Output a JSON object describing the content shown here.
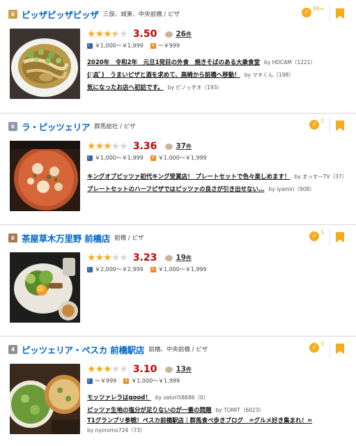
{
  "restaurants": [
    {
      "rank_label": "",
      "rank_style": "gold",
      "name": "ピッザピッザピッザ",
      "area": "三俣、城東、中央前橋 / ピザ",
      "save_count": "99+",
      "rating": 3.5,
      "score": "3.50",
      "review_count": "26",
      "review_unit": "件",
      "dinner_price": "￥1,000～￥1,999",
      "lunch_price": "～￥999",
      "reviews": [
        {
          "title": "2020年　令和2年　元旦1発目の外食　焼きそばのある大衆食堂",
          "by": "by HDCAM（1221）"
        },
        {
          "title": "(ﾟДﾟ)　うまいピザと酒を求めて、高崎から前橋へ移動！",
          "by": "by マキくん（198）"
        },
        {
          "title": "気になったお店へ初訪です。",
          "by": "by ピノッチオ（193）"
        }
      ]
    },
    {
      "rank_label": "",
      "rank_style": "silver",
      "name": "ラ・ピッツェリア",
      "area": "群馬総社 / ピザ",
      "save_count": "2",
      "rating": 3.0,
      "score": "3.36",
      "review_count": "37",
      "review_unit": "件",
      "dinner_price": "￥1,000～￥1,999",
      "lunch_price": "￥1,000～￥1,999",
      "reviews": [
        {
          "title": "キングオブピッツァ初代キング受賞店！ プレートセットで色々楽しめます！",
          "by": "by まっすーTV（37）"
        },
        {
          "title": "プレートセットのハーフピザではピッツァの良さが引き出せない…",
          "by": "by iyamin（908）"
        }
      ]
    },
    {
      "rank_label": "",
      "rank_style": "bronze",
      "name": "茶屋草木万里野 前橋店",
      "area": "前橋 / ピザ",
      "save_count": "1",
      "rating": 3.0,
      "score": "3.23",
      "review_count": "19",
      "review_unit": "件",
      "dinner_price": "￥2,000～￥2,999",
      "lunch_price": "￥1,000～￥1,999",
      "reviews": []
    },
    {
      "rank_label": "4",
      "rank_style": "plain",
      "name": "ピッツェリア・ペスカ 前橋駅店",
      "area": "前橋、中央前橋 / ピザ",
      "save_count": "3",
      "rating": 3.0,
      "score": "3.10",
      "review_count": "13",
      "review_unit": "件",
      "dinner_price": "～￥999",
      "lunch_price": "￥1,000～￥1,999",
      "reviews": [
        {
          "title": "モッツァレラはgood！",
          "by": "by satori58686（0）"
        },
        {
          "title": "ピッツァ生地の塩分が足りないのが一番の問題",
          "by": "by TOMIT（6023）"
        },
        {
          "title": "T1グランプリ参戦！ペスカ前橋駅店｜群馬食べ歩きブログ　=グルメ好き集まれ！=",
          "by": "by nyoromo724（73）",
          "wrap": true
        }
      ]
    }
  ],
  "colors": {
    "link": "#0066cc",
    "score": "#c80000",
    "accent": "#f3ac1c"
  }
}
